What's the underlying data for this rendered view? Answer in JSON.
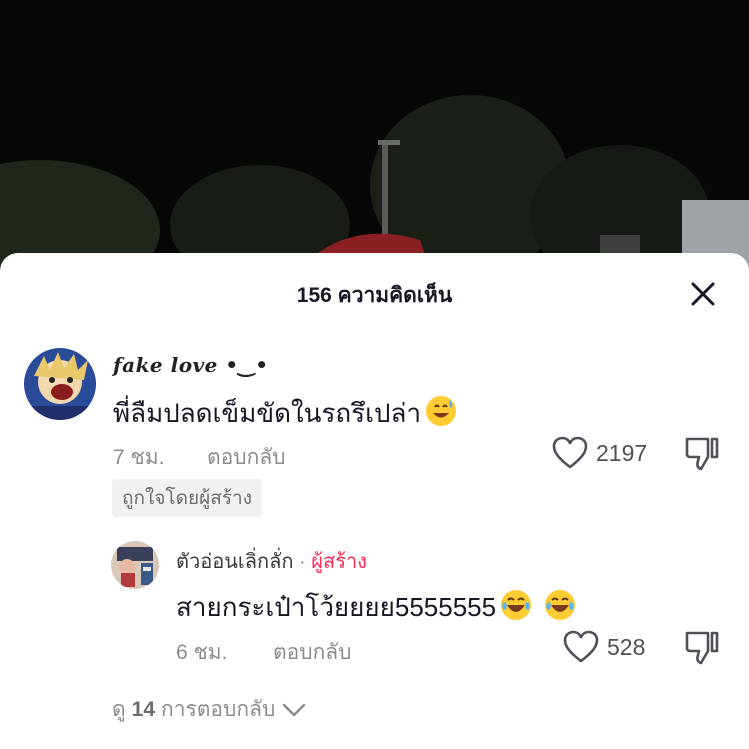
{
  "sheet": {
    "title": "156 ความคิดเห็น"
  },
  "comment": {
    "username": "fake love •‿•",
    "text": "พี่ลืมปลดเข็มขัดในรถรึเปล่า",
    "emoji": "grinning-sweat-emoji",
    "time": "7 ชม.",
    "reply_label": "ตอบกลับ",
    "likes": "2197",
    "creator_liked_badge": "ถูกใจโดยผู้สร้าง"
  },
  "reply": {
    "username": "ตัวอ่อนเลิ่กลั่ก",
    "separator": "·",
    "creator_label": "ผู้สร้าง",
    "text": "สายกระเป๋าโว้ยยยย5555555",
    "emojis": [
      "tears-of-joy-emoji",
      "tears-of-joy-emoji"
    ],
    "time": "6 ชม.",
    "reply_label": "ตอบกลับ",
    "likes": "528"
  },
  "view_replies": {
    "prefix": "ดู",
    "count": "14",
    "suffix": "การตอบกลับ"
  },
  "colors": {
    "creator_accent": "#fe2c55",
    "muted_text": "#8a8b91"
  }
}
